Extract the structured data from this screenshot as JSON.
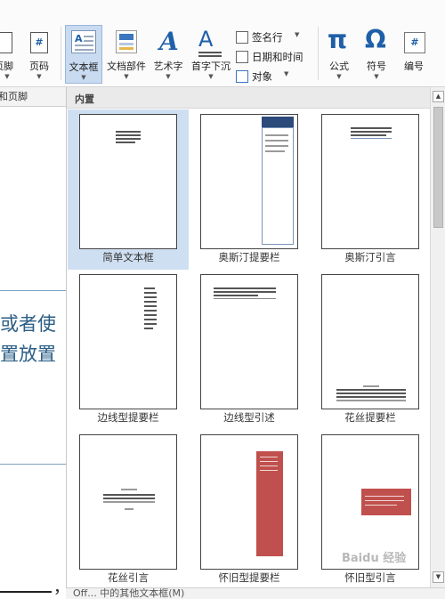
{
  "ribbon": {
    "footer_btn": "页脚",
    "pagenum_btn": "页码",
    "textbox_btn": "文本框",
    "docparts_btn": "文档部件",
    "wordart_btn": "艺术字",
    "dropcap_btn": "首字下沉",
    "signature_btn": "签名行",
    "datetime_btn": "日期和时间",
    "object_btn": "对象",
    "equation_btn": "公式",
    "symbol_btn": "符号",
    "number_btn": "编号",
    "group_header_footer": "和页脚",
    "icons": {
      "page_number": "#",
      "wordart": "A",
      "dropcap": "A",
      "equation": "π",
      "symbol": "Ω",
      "number": "#"
    }
  },
  "document": {
    "line1": "或者使",
    "line2": "置放置",
    "bottom_mark": "，"
  },
  "gallery": {
    "section_label": "内置",
    "tiles": [
      {
        "label": "简单文本框",
        "selected": true
      },
      {
        "label": "奥斯汀提要栏",
        "selected": false
      },
      {
        "label": "奥斯汀引言",
        "selected": false
      },
      {
        "label": "边线型提要栏",
        "selected": false
      },
      {
        "label": "边线型引述",
        "selected": false
      },
      {
        "label": "花丝提要栏",
        "selected": false
      },
      {
        "label": "花丝引言",
        "selected": false
      },
      {
        "label": "怀旧型提要栏",
        "selected": false
      },
      {
        "label": "怀旧型引言",
        "selected": false
      }
    ],
    "footer_text": "Off...   中的其他文本框(M)"
  },
  "watermark": "Baidu 经验",
  "colors": {
    "accent_blue": "#1e5fa8",
    "selection": "#cfdff2",
    "austin_bar": "#2c4a7a",
    "retro_red": "#c0504d",
    "doc_text": "#2b5e86"
  }
}
